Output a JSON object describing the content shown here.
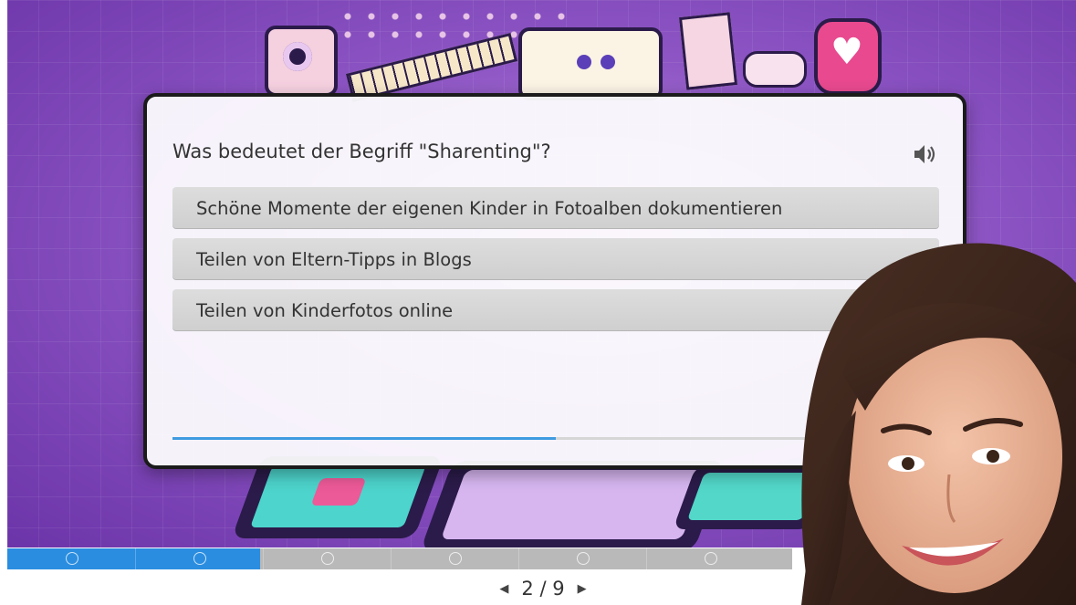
{
  "quiz": {
    "question": "Was bedeutet der Begriff \"Sharenting\"?",
    "answers": [
      "Schöne Momente der eigenen Kinder in Fotoalben dokumentieren",
      "Teilen von Eltern-Tipps in Blogs",
      "Teilen von Kinderfotos online"
    ],
    "timer_remaining": 0.5
  },
  "icons": {
    "audio": "speaker-icon",
    "prev": "triangle-left-icon",
    "next": "triangle-right-icon"
  },
  "slides": {
    "current": 2,
    "total": 9,
    "label": "2 / 9",
    "progress_fraction": 0.3225
  },
  "colors": {
    "accent_blue": "#2a8de0",
    "background_purple": "#8d55c4",
    "answer_gray": "#d5d5d5"
  }
}
